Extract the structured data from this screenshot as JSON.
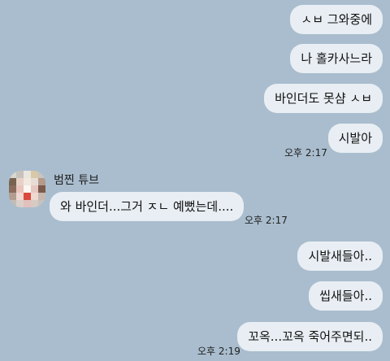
{
  "chat": {
    "messages": [
      {
        "sender": "me",
        "text": "ㅅㅂ 그와중에"
      },
      {
        "sender": "me",
        "text": "나 홀카사느라"
      },
      {
        "sender": "me",
        "text": "바인더도 못샴 ㅅㅂ"
      },
      {
        "sender": "me",
        "text": "시발아",
        "time": "오후 2:17"
      },
      {
        "sender": "other",
        "name": "범찐 튜브",
        "text": "와 바인더...그거 ㅈㄴ 예뻤는데....",
        "time": "오후 2:17"
      },
      {
        "sender": "me",
        "text": "시발새들아.."
      },
      {
        "sender": "me",
        "text": "씹새들아.."
      },
      {
        "sender": "me",
        "text": "꼬옥...꼬옥 죽어주면되..",
        "time": "오후 2:19"
      }
    ]
  },
  "avatar_pixels": [
    "#d9d6d0",
    "#c7c2bb",
    "#e9e6dd",
    "#d7c8a8",
    "#c9c4bd",
    "#7a6250",
    "#e8d2c7",
    "#f1e8df",
    "#e7ddd5",
    "#b49a8b",
    "#8b6c5c",
    "#e9c5bd",
    "#fbf6f1",
    "#e6c7c1",
    "#7b5a4c",
    "#b29d91",
    "#f0d7d2",
    "#d94a3c",
    "#edd8d2",
    "#c7b8ae",
    "#c3bcb7",
    "#dbcfc9",
    "#e3c0bc",
    "#d5cbc4",
    "#c8c1bc"
  ]
}
